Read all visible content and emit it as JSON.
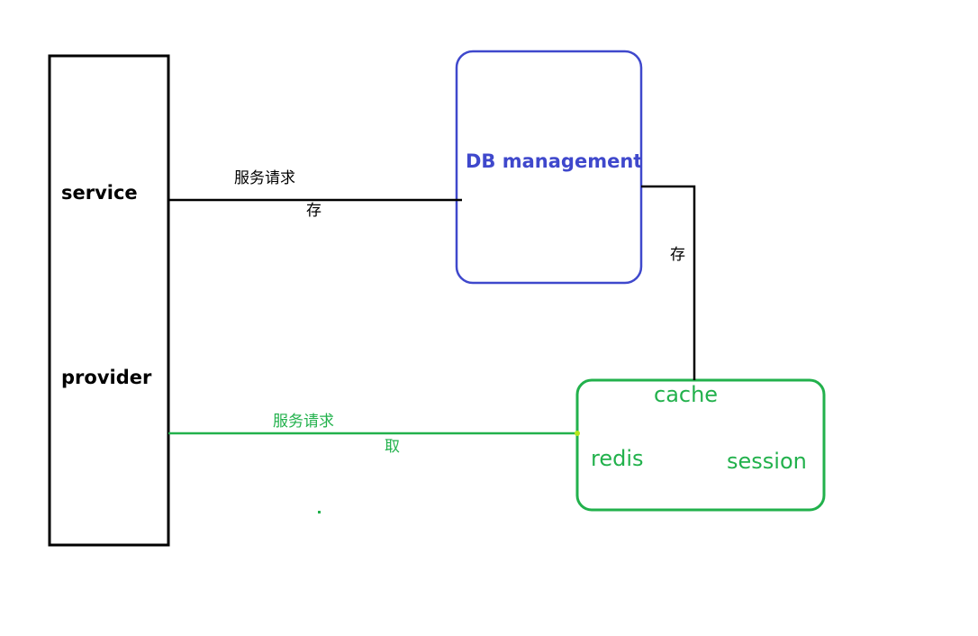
{
  "service_box": {
    "label_top": "service",
    "label_bottom": "provider"
  },
  "db_box": {
    "label": "DB management"
  },
  "cache_box": {
    "title": "cache",
    "item_left": "redis",
    "item_right": "session"
  },
  "edges": {
    "service_to_db": {
      "label_above": "服务请求",
      "label_below": "存"
    },
    "db_to_cache": {
      "label": "存"
    },
    "service_to_cache": {
      "label_above": "服务请求",
      "label_below": "取"
    }
  },
  "colors": {
    "black": "#000000",
    "blue": "#3f48cc",
    "green": "#22b14c"
  }
}
